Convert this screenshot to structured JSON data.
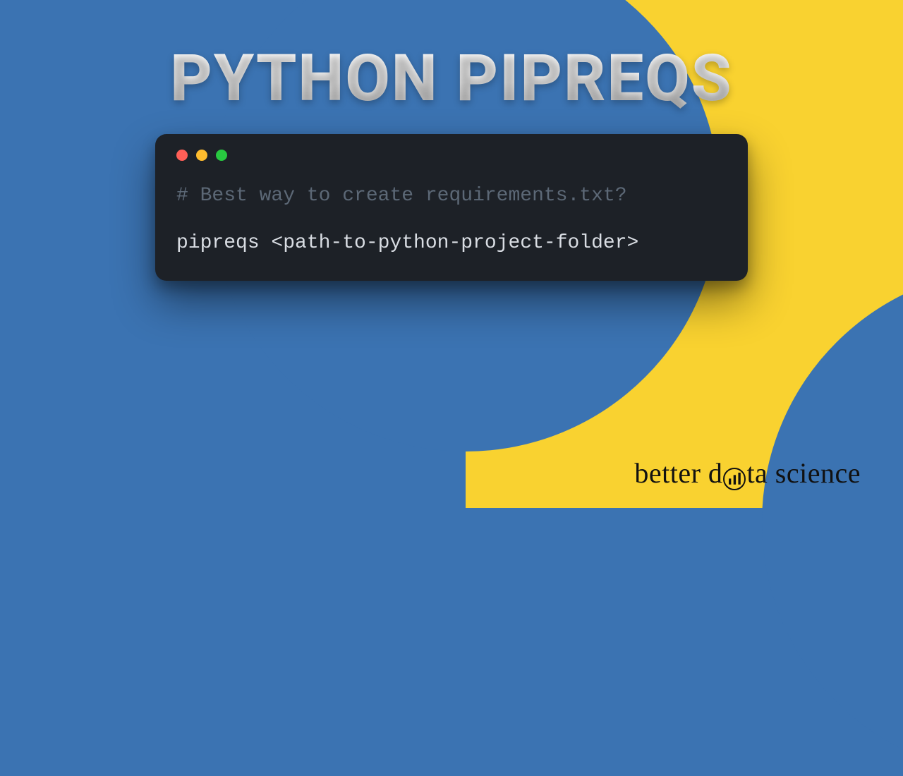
{
  "title": "PYTHON PIPREQS",
  "terminal": {
    "comment": "# Best way to create requirements.txt?",
    "command": "pipreqs <path-to-python-project-folder>"
  },
  "brand": {
    "left": "better d",
    "right": "ta science"
  },
  "colors": {
    "blue": "#3b73b2",
    "yellow": "#f9d230",
    "terminal_bg": "#1d2127"
  }
}
